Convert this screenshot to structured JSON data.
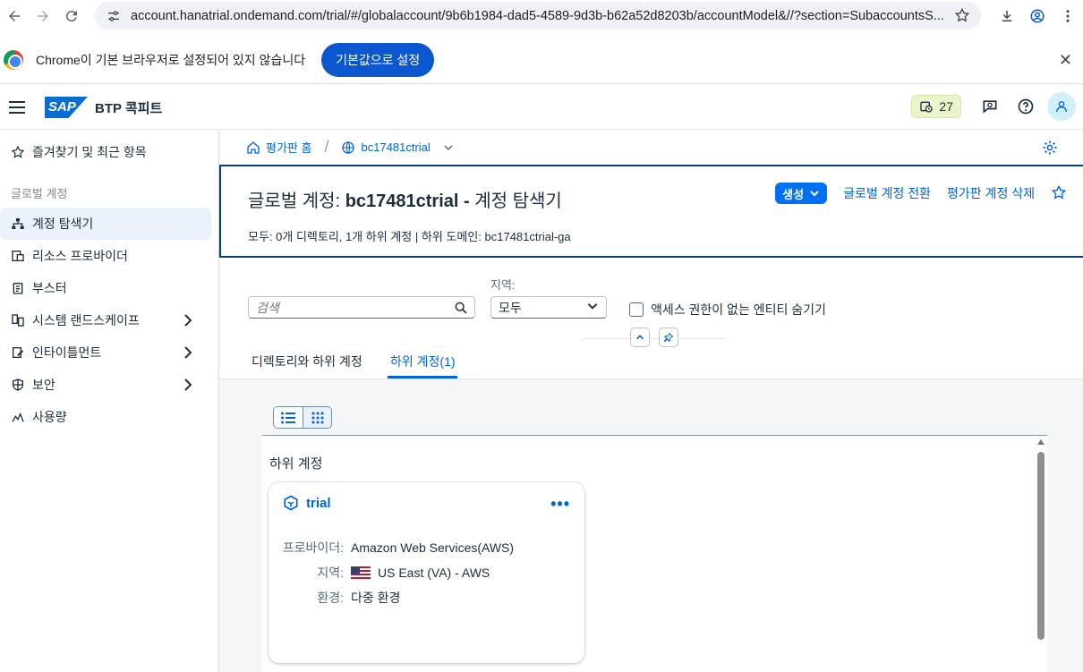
{
  "browser": {
    "url": "account.hanatrial.ondemand.com/trial/#/globalaccount/9b6b1984-dad5-4589-9d3b-b62a52d8203b/accountModel&//?section=SubaccountsS..."
  },
  "infobar": {
    "message": "Chrome이 기본 브라우저로 설정되어 있지 않습니다",
    "button": "기본값으로 설정"
  },
  "shell": {
    "logo": "SAP",
    "title": "BTP 콕피트",
    "notifications_count": "27"
  },
  "sidenav": {
    "favorites": "즐겨찾기 및 최근 항목",
    "group_label": "글로벌 계정",
    "items": [
      {
        "label": "계정 탐색기",
        "icon": "hierarchy-icon"
      },
      {
        "label": "리소스 프로바이더",
        "icon": "resource-provider-icon"
      },
      {
        "label": "부스터",
        "icon": "booster-icon"
      },
      {
        "label": "시스템 랜드스케이프",
        "icon": "landscape-icon"
      },
      {
        "label": "인타이틀먼트",
        "icon": "entitlement-icon"
      },
      {
        "label": "보안",
        "icon": "shield-icon"
      },
      {
        "label": "사용량",
        "icon": "usage-icon"
      }
    ]
  },
  "breadcrumb": {
    "home": "평가판 홈",
    "account": "bc17481ctrial"
  },
  "header": {
    "title_prefix": "글로벌 계정:",
    "title_name": "bc17481ctrial -",
    "title_suffix": "계정 탐색기",
    "subtitle": "모두: 0개 디렉토리, 1개 하위 계정 | 하위 도메인: bc17481ctrial-ga",
    "create_button": "생성",
    "switch_link": "글로벌 계정 전환",
    "delete_link": "평가판 계정 삭제"
  },
  "filters": {
    "search_placeholder": "검색",
    "region_label": "지역:",
    "region_value": "모두",
    "hide_checkbox_label": "액세스 권한이 없는 엔티티 숨기기"
  },
  "tabs": {
    "tab1": "디렉토리와 하위 계정",
    "tab2": "하위 계정(1)"
  },
  "subaccounts": {
    "section_title": "하위 계정",
    "card": {
      "name": "trial",
      "provider_label": "프로바이더:",
      "provider_value": "Amazon Web Services(AWS)",
      "region_label": "지역:",
      "region_value": "US East (VA) - AWS",
      "env_label": "환경:",
      "env_value": "다중 환경"
    }
  }
}
